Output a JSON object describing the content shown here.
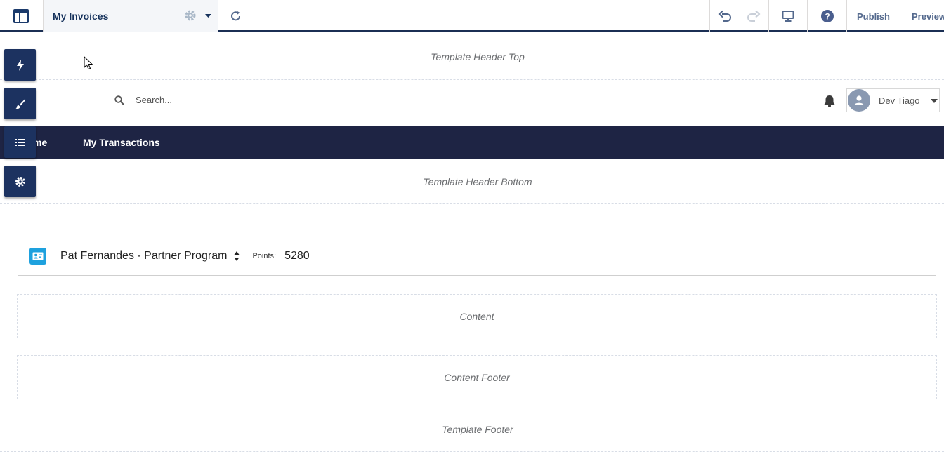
{
  "toolbar": {
    "page_name": "My Invoices",
    "publish_label": "Publish",
    "preview_label": "Preview"
  },
  "regions": {
    "header_top": "Template Header Top",
    "header_bottom": "Template Header Bottom",
    "content": "Content",
    "content_footer": "Content Footer",
    "footer": "Template Footer"
  },
  "search": {
    "placeholder": "Search..."
  },
  "user": {
    "name": "Dev Tiago"
  },
  "nav": {
    "items": [
      {
        "label": "me"
      },
      {
        "label": "My Transactions"
      }
    ]
  },
  "member": {
    "name": "Pat Fernandes - Partner Program",
    "points_label": "Points:",
    "points_value": "5280"
  },
  "tools": [
    "lightning-icon",
    "brush-icon",
    "list-icon",
    "settings-icon"
  ],
  "colors": {
    "toolbar_border": "#1b2f54",
    "navbar_bg": "#1e2444",
    "tool_btn_bg": "#1c3260",
    "member_icon_bg": "#1ea1de"
  }
}
